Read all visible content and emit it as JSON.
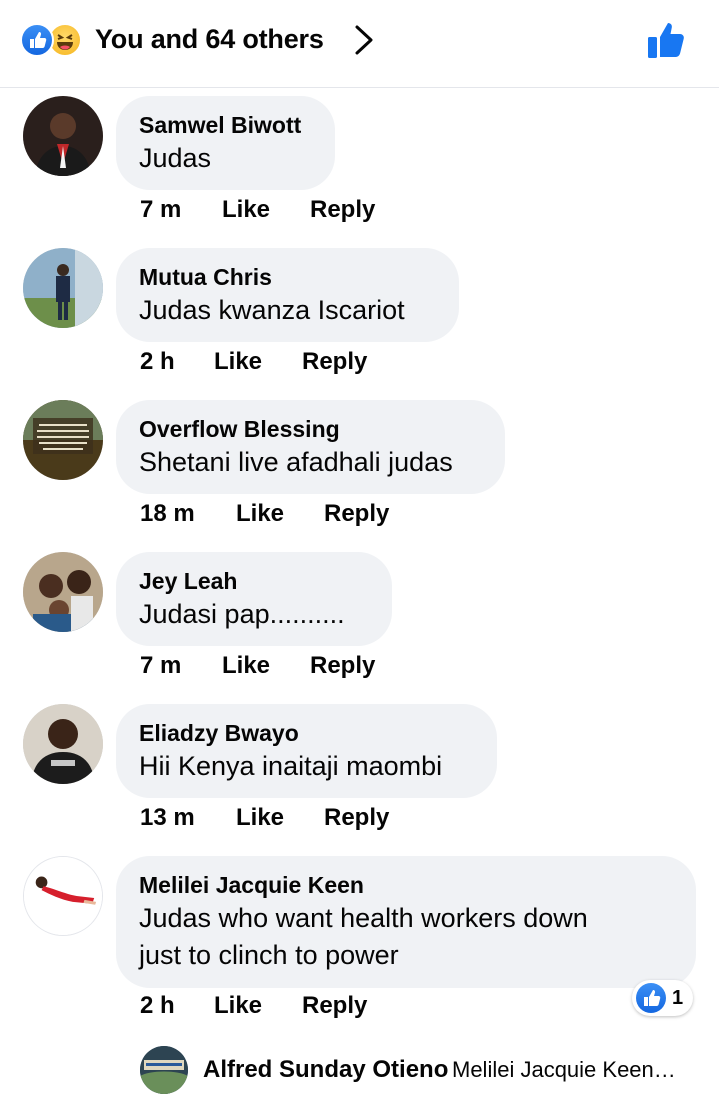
{
  "header": {
    "title": "You and 64 others",
    "reaction_icons": [
      "like-icon",
      "haha-icon"
    ],
    "accent": "#1877f2"
  },
  "comments": [
    {
      "name": "Samwel Biwott",
      "text": [
        "Judas"
      ],
      "time": "7 m",
      "like": "Like",
      "reply": "Reply"
    },
    {
      "name": "Mutua Chris",
      "text": [
        "Judas kwanza Iscariot"
      ],
      "time": "2 h",
      "like": "Like",
      "reply": "Reply"
    },
    {
      "name": "Overflow Blessing",
      "text": [
        "Shetani live afadhali judas"
      ],
      "time": "18 m",
      "like": "Like",
      "reply": "Reply"
    },
    {
      "name": "Jey Leah",
      "text": [
        "Judasi pap.........."
      ],
      "time": "7 m",
      "like": "Like",
      "reply": "Reply"
    },
    {
      "name": "Eliadzy Bwayo",
      "text": [
        "Hii Kenya inaitaji maombi"
      ],
      "time": "13 m",
      "like": "Like",
      "reply": "Reply"
    },
    {
      "name": "Melilei Jacquie Keen",
      "text": [
        "Judas who want health workers down",
        "just to clinch to power"
      ],
      "time": "2 h",
      "like": "Like",
      "reply": "Reply",
      "reaction_count": "1"
    }
  ],
  "reply_preview": {
    "name": "Alfred Sunday Otieno",
    "text": "Melilei Jacquie Keen…"
  }
}
